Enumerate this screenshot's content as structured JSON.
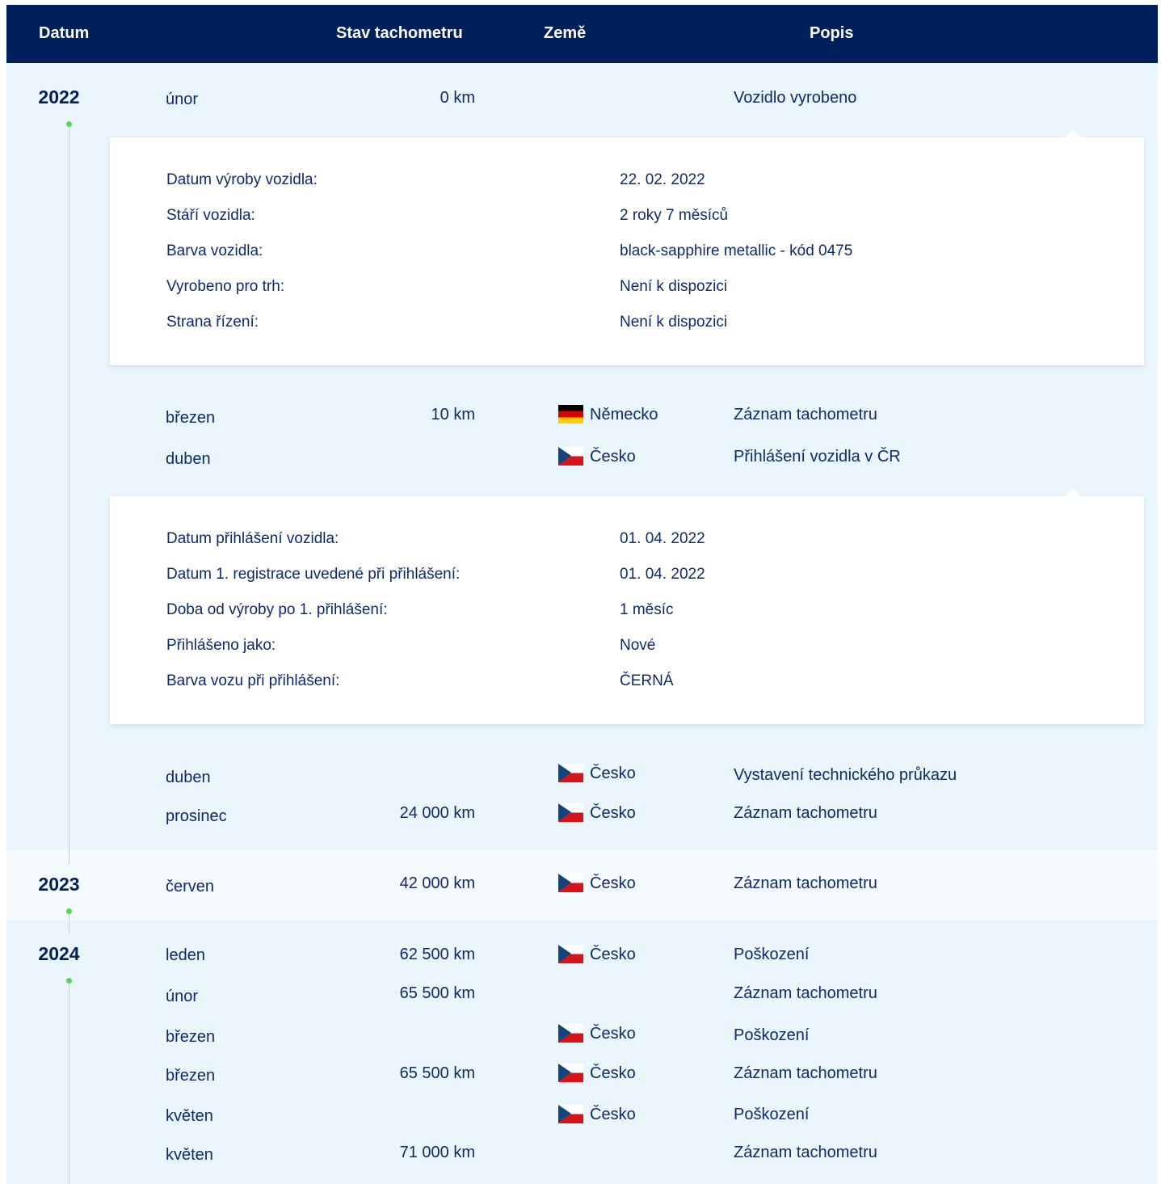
{
  "header": {
    "datum": "Datum",
    "odometer": "Stav tachometru",
    "country": "Země",
    "description": "Popis"
  },
  "colors": {
    "header_bg": "#00205b",
    "band_light": "#eaf6fc",
    "band_lighter": "#f4fafd",
    "dot": "#5bd15b",
    "line": "#a9d9d9"
  },
  "years": [
    {
      "year": "2022",
      "rows": [
        {
          "month": "únor",
          "odometer": "0 km",
          "country": "",
          "flag": "",
          "description": "Vozidlo vyrobeno"
        },
        {
          "month": "březen",
          "odometer": "10 km",
          "country": "Německo",
          "flag": "germany-flag-icon",
          "description": "Záznam tachometru"
        },
        {
          "month": "duben",
          "odometer": "",
          "country": "Česko",
          "flag": "czech-flag-icon",
          "description": "Přihlášení vozidla v ČR"
        },
        {
          "month": "duben",
          "odometer": "",
          "country": "Česko",
          "flag": "czech-flag-icon",
          "description": "Vystavení technického průkazu"
        },
        {
          "month": "prosinec",
          "odometer": "24 000 km",
          "country": "Česko",
          "flag": "czech-flag-icon",
          "description": "Záznam tachometru"
        }
      ]
    },
    {
      "year": "2023",
      "rows": [
        {
          "month": "červen",
          "odometer": "42 000 km",
          "country": "Česko",
          "flag": "czech-flag-icon",
          "description": "Záznam tachometru"
        }
      ]
    },
    {
      "year": "2024",
      "rows": [
        {
          "month": "leden",
          "odometer": "62 500 km",
          "country": "Česko",
          "flag": "czech-flag-icon",
          "description": "Poškození"
        },
        {
          "month": "únor",
          "odometer": "65 500 km",
          "country": "",
          "flag": "",
          "description": "Záznam tachometru"
        },
        {
          "month": "březen",
          "odometer": "",
          "country": "Česko",
          "flag": "czech-flag-icon",
          "description": "Poškození"
        },
        {
          "month": "březen",
          "odometer": "65 500 km",
          "country": "Česko",
          "flag": "czech-flag-icon",
          "description": "Záznam tachometru"
        },
        {
          "month": "květen",
          "odometer": "",
          "country": "Česko",
          "flag": "czech-flag-icon",
          "description": "Poškození"
        },
        {
          "month": "květen",
          "odometer": "71 000 km",
          "country": "",
          "flag": "",
          "description": "Záznam tachometru"
        }
      ]
    }
  ],
  "panels": {
    "production": [
      {
        "label": "Datum výroby vozidla:",
        "value": "22. 02. 2022"
      },
      {
        "label": "Stáří vozidla:",
        "value": "2 roky 7 měsíců"
      },
      {
        "label": "Barva vozidla:",
        "value": "black-sapphire metallic - kód 0475"
      },
      {
        "label": "Vyrobeno pro trh:",
        "value": "Není k dispozici"
      },
      {
        "label": "Strana řízení:",
        "value": "Není k dispozici"
      }
    ],
    "registration": [
      {
        "label": "Datum přihlášení vozidla:",
        "value": "01. 04. 2022"
      },
      {
        "label": "Datum 1. registrace uvedené při přihlášení:",
        "value": "01. 04. 2022"
      },
      {
        "label": "Doba od výroby po 1. přihlášení:",
        "value": "1 měsíc"
      },
      {
        "label": "Přihlášeno jako:",
        "value": "Nové"
      },
      {
        "label": "Barva vozu při přihlášení:",
        "value": "ČERNÁ"
      }
    ]
  }
}
